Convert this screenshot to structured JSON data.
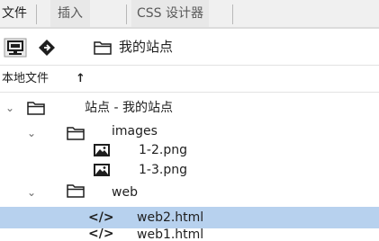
{
  "tabs": [
    {
      "label": "文件",
      "active": true
    },
    {
      "label": "插入",
      "active": false
    },
    {
      "label": "CSS 设计器",
      "active": false
    }
  ],
  "toolbar": {
    "connect_icon": "monitor-connect-icon",
    "sync_icon": "diamond-sync-icon",
    "site_selector": {
      "icon": "folder-icon",
      "value": "我的站点"
    }
  },
  "local_files": {
    "label": "本地文件",
    "sort_icon": "up-arrow-icon",
    "sort_glyph": "↑"
  },
  "tree": [
    {
      "type": "folder",
      "label": "站点 - 我的站点",
      "expanded": true,
      "selected": false,
      "chevron": "⌄"
    },
    {
      "type": "folder",
      "label": "images",
      "expanded": true,
      "selected": false,
      "chevron": "⌄"
    },
    {
      "type": "image",
      "label": "1-2.png",
      "selected": false
    },
    {
      "type": "image",
      "label": "1-3.png",
      "selected": false
    },
    {
      "type": "folder",
      "label": "web",
      "expanded": true,
      "selected": false,
      "chevron": "⌄"
    },
    {
      "type": "html",
      "label": "web2.html",
      "selected": true,
      "glyph": "</>"
    },
    {
      "type": "html",
      "label": "web1.html",
      "selected": false,
      "glyph": "</>"
    }
  ],
  "colors": {
    "selection": "#b7d1ee",
    "tab_bg": "#f0f0f0",
    "text": "#1e1e1e"
  }
}
